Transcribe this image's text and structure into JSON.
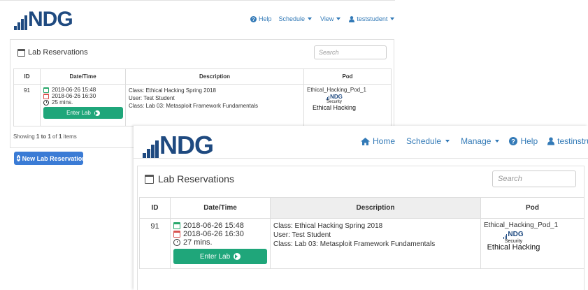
{
  "brand": {
    "logo_text": "NDG"
  },
  "back_window": {
    "nav": {
      "help": "Help",
      "schedule": "Schedule",
      "view": "View",
      "user": "teststudent"
    },
    "card_title": "Lab Reservations",
    "search_placeholder": "Search",
    "table": {
      "headers": [
        "ID",
        "Date/Time",
        "Description",
        "Pod"
      ],
      "row": {
        "id": "91",
        "start": "2018-06-26 15:48",
        "end": "2018-06-26 16:30",
        "duration": "25 mins.",
        "enter_label": "Enter Lab",
        "class_line": "Class: Ethical Hacking Spring 2018",
        "user_line": "User: Test Student",
        "lab_line": "Class: Lab 03: Metasploit Framework Fundamentals",
        "pod_name": "Ethical_Hacking_Pod_1",
        "pod_logo_brand": "NDG",
        "pod_logo_line1": "Security",
        "pod_logo_line2": "Ethical Hacking"
      }
    },
    "footer": {
      "showing_prefix": "Showing ",
      "showing_range": "1 to 1",
      "showing_of": " of ",
      "showing_total": "1",
      "showing_suffix": " items"
    },
    "new_button": "New Lab Reservation"
  },
  "front_window": {
    "nav": {
      "home": "Home",
      "schedule": "Schedule",
      "manage": "Manage",
      "help": "Help",
      "user": "testinstructor"
    },
    "card_title": "Lab Reservations",
    "search_placeholder": "Search",
    "table": {
      "headers": [
        "ID",
        "Date/Time",
        "Description",
        "Pod"
      ],
      "row": {
        "id": "91",
        "start": "2018-06-26 15:48",
        "end": "2018-06-26 16:30",
        "duration": "27 mins.",
        "enter_label": "Enter Lab",
        "class_line": "Class: Ethical Hacking Spring 2018",
        "user_line": "User: Test Student",
        "lab_line": "Class: Lab 03: Metasploit Framework Fundamentals",
        "pod_name": "Ethical_Hacking_Pod_1",
        "pod_logo_brand": "NDG",
        "pod_logo_line1": "Security",
        "pod_logo_line2": "Ethical Hacking"
      }
    }
  },
  "colors": {
    "brand_blue": "#1f4a80",
    "link_blue": "#337ab7",
    "enter_green": "#1fa67a",
    "start_green": "#27a76a",
    "end_red": "#d9534f",
    "new_button_blue": "#3a7bd5"
  }
}
